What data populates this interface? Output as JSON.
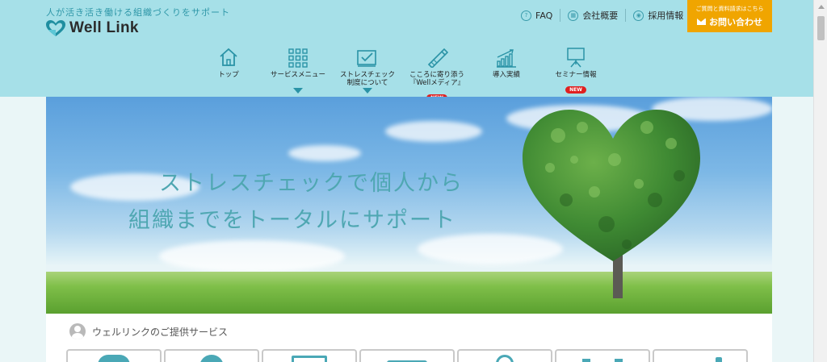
{
  "header": {
    "tagline": "人が活き活き働ける組織づくりをサポート",
    "logo_text": "Well Link",
    "utility_links": [
      {
        "label": "FAQ",
        "icon": "question-icon"
      },
      {
        "label": "会社概要",
        "icon": "building-icon"
      },
      {
        "label": "採用情報",
        "icon": "recruit-icon"
      }
    ],
    "contact": {
      "small_text": "ご質問と資料請求はこちら",
      "main_text": "お問い合わせ",
      "color": "#f0a500"
    },
    "nav": [
      {
        "label": "トップ",
        "icon": "home-icon",
        "caret": false,
        "badge": ""
      },
      {
        "label": "サービスメニュー",
        "icon": "grid-icon",
        "caret": true,
        "badge": ""
      },
      {
        "label_line1": "ストレスチェック",
        "label_line2": "制度について",
        "icon": "checklist-icon",
        "caret": true,
        "badge": ""
      },
      {
        "label_line1": "こころに寄り添う",
        "label_line2": "『Wellメディア』",
        "icon": "pen-icon",
        "caret": false,
        "badge": "NEW"
      },
      {
        "label": "導入実績",
        "icon": "bar-chart-icon",
        "caret": false,
        "badge": ""
      },
      {
        "label": "セミナー情報",
        "icon": "presentation-icon",
        "caret": false,
        "badge": "NEW"
      }
    ]
  },
  "hero": {
    "line1": "ストレスチェックで個人から",
    "line2": "組織までをトータルにサポート"
  },
  "services": {
    "title": "ウェルリンクのご提供サービス"
  },
  "colors": {
    "header_bg": "#a6e0e8",
    "accent": "#2a93a6",
    "badge": "#e02020"
  }
}
